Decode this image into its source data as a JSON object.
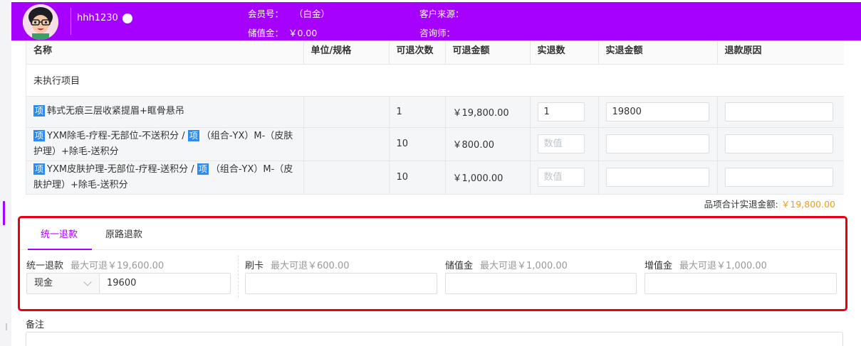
{
  "member": {
    "username": "hhh1230",
    "member_no_label": "会员号：",
    "member_level": "（白金）",
    "stored_value_label": "储值金：",
    "stored_value": "￥0.00",
    "source_label": "客户来源：",
    "consultant_label": "咨询师："
  },
  "table": {
    "headers": [
      "名称",
      "单位/规格",
      "可退次数",
      "可退金额",
      "实退数",
      "实退金额",
      "退款原因"
    ],
    "group_label": "未执行项目",
    "tag_label": "项",
    "rows": [
      {
        "name": "韩式无痕三层收紧提眉+眶骨悬吊",
        "name2": "",
        "unit": "",
        "count": "1",
        "amount": "￥19,800.00",
        "qty_value": "1",
        "refund_value": "19800",
        "reason": ""
      },
      {
        "name": "YXM除毛-疗程-无部位-不送积分 /",
        "name2": "（组合-YX）M-（皮肤护理）+除毛-送积分",
        "unit": "",
        "count": "10",
        "amount": "￥800.00",
        "qty_placeholder": "数值",
        "refund_value": "",
        "reason": ""
      },
      {
        "name": "YXM皮肤护理-无部位-疗程-送积分 /",
        "name2": "（组合-YX）M-（皮肤护理）+除毛-送积分",
        "unit": "",
        "count": "10",
        "amount": "￥1,000.00",
        "qty_placeholder": "数值",
        "refund_value": "",
        "reason": ""
      }
    ]
  },
  "subtotal": {
    "label": "品项合计实退金额:",
    "amount": "￥19,800.00"
  },
  "refund": {
    "tabs": [
      "统一退款",
      "原路退款"
    ],
    "active_tab": 0,
    "methods": [
      {
        "label": "统一退款",
        "hint": "最大可退￥19,600.00",
        "select_value": "现金",
        "value": "19600"
      },
      {
        "label": "刷卡",
        "hint": "最大可退￥600.00",
        "value": ""
      },
      {
        "label": "储值金",
        "hint": "最大可退￥1,000.00",
        "value": ""
      },
      {
        "label": "增值金",
        "hint": "最大可退￥1,000.00",
        "value": ""
      }
    ]
  },
  "remark": {
    "label": "备注",
    "value": ""
  },
  "colors": {
    "brand": "#a600ff",
    "highlight_border": "#e60012",
    "amount": "#ff9900",
    "tag": "#2d8cf0"
  }
}
